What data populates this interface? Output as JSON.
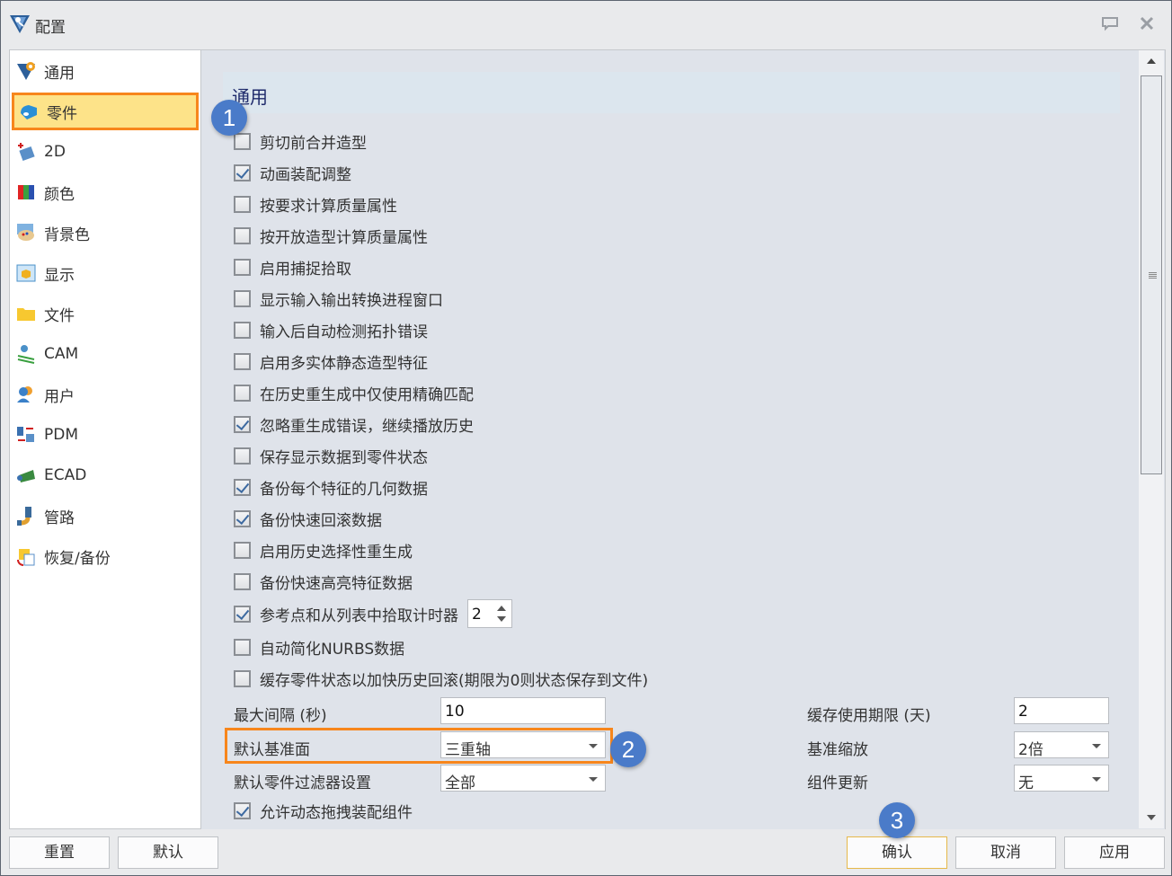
{
  "window": {
    "title": "配置",
    "feedback_icon": "speech-bubble-icon",
    "close_icon": "close-x-icon"
  },
  "sidebar": {
    "selected": "零件",
    "items": [
      {
        "label": "通用",
        "icon": "gear-triangle-icon"
      },
      {
        "label": "零件",
        "icon": "part-icon"
      },
      {
        "label": "2D",
        "icon": "drawing-2d-icon"
      },
      {
        "label": "颜色",
        "icon": "color-bars-icon"
      },
      {
        "label": "背景色",
        "icon": "palette-icon"
      },
      {
        "label": "显示",
        "icon": "display-cube-icon"
      },
      {
        "label": "文件",
        "icon": "folder-icon"
      },
      {
        "label": "CAM",
        "icon": "cam-icon"
      },
      {
        "label": "用户",
        "icon": "users-icon"
      },
      {
        "label": "PDM",
        "icon": "pdm-icon"
      },
      {
        "label": "ECAD",
        "icon": "circuit-board-icon"
      },
      {
        "label": "管路",
        "icon": "pipe-icon"
      },
      {
        "label": "恢复/备份",
        "icon": "restore-backup-icon"
      }
    ]
  },
  "main": {
    "section_title": "通用",
    "checkboxes": [
      {
        "label": "剪切前合并造型",
        "checked": false
      },
      {
        "label": "动画装配调整",
        "checked": true
      },
      {
        "label": "按要求计算质量属性",
        "checked": false
      },
      {
        "label": "按开放造型计算质量属性",
        "checked": false
      },
      {
        "label": "启用捕捉拾取",
        "checked": false
      },
      {
        "label": "显示输入输出转换进程窗口",
        "checked": false
      },
      {
        "label": "输入后自动检测拓扑错误",
        "checked": false
      },
      {
        "label": "启用多实体静态造型特征",
        "checked": false
      },
      {
        "label": "在历史重生成中仅使用精确匹配",
        "checked": false
      },
      {
        "label": "忽略重生成错误，继续播放历史",
        "checked": true
      },
      {
        "label": "保存显示数据到零件状态",
        "checked": false
      },
      {
        "label": "备份每个特征的几何数据",
        "checked": true
      },
      {
        "label": "备份快速回滚数据",
        "checked": true
      },
      {
        "label": "启用历史选择性重生成",
        "checked": false
      },
      {
        "label": "备份快速高亮特征数据",
        "checked": false
      },
      {
        "label": "参考点和从列表中拾取计时器",
        "checked": true
      },
      {
        "label": "自动简化NURBS数据",
        "checked": false
      },
      {
        "label": "缓存零件状态以加快历史回滚(期限为0则状态保存到文件)",
        "checked": false
      }
    ],
    "timer_value": "2",
    "fields_left": [
      {
        "label": "最大间隔 (秒)",
        "type": "text",
        "value": "10"
      },
      {
        "label": "默认基准面",
        "type": "select",
        "value": "三重轴"
      },
      {
        "label": "默认零件过滤器设置",
        "type": "select",
        "value": "全部"
      }
    ],
    "fields_right": [
      {
        "label": "缓存使用期限 (天)",
        "type": "text",
        "value": "2"
      },
      {
        "label": "基准缩放",
        "type": "select",
        "value": "2倍"
      },
      {
        "label": "组件更新",
        "type": "select",
        "value": "无"
      }
    ],
    "last_checkbox": {
      "label": "允许动态拖拽装配组件",
      "checked": true
    }
  },
  "annotations": {
    "badge1": "1",
    "badge2": "2",
    "badge3": "3",
    "highlight_color": "#f7861c",
    "badge_color": "#4a7bc9"
  },
  "footer": {
    "reset": "重置",
    "default": "默认",
    "ok": "确认",
    "cancel": "取消",
    "apply": "应用"
  }
}
